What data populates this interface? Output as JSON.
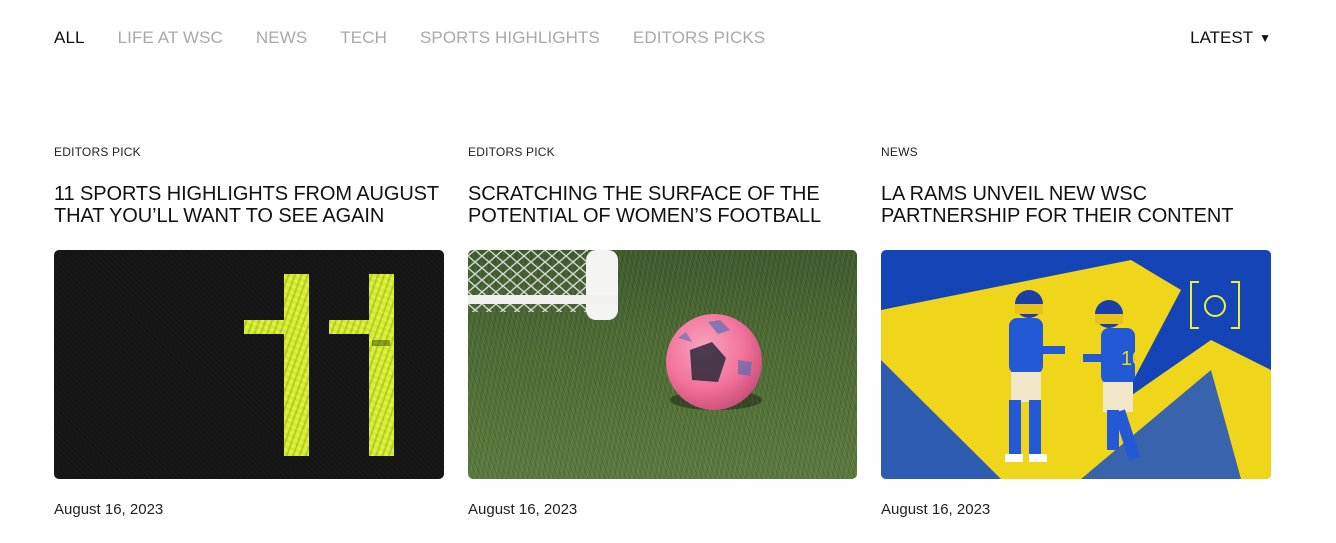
{
  "filters": {
    "items": [
      {
        "label": "ALL",
        "active": true
      },
      {
        "label": "LIFE AT WSC",
        "active": false
      },
      {
        "label": "NEWS",
        "active": false
      },
      {
        "label": "TECH",
        "active": false
      },
      {
        "label": "SPORTS HIGHLIGHTS",
        "active": false
      },
      {
        "label": "EDITORS PICKS",
        "active": false
      }
    ],
    "sort_label": "LATEST",
    "sort_icon": "caret-down-icon"
  },
  "cards": [
    {
      "category": "EDITORS PICK",
      "title_line1": "11 SPORTS HIGHLIGHTS FROM AUGUST",
      "title_line2": "THAT YOU’LL WANT TO SEE AGAIN",
      "date": "August 16, 2023",
      "image": "number-eleven-graphic",
      "image_text": "11"
    },
    {
      "category": "EDITORS PICK",
      "title_line1": "SCRATCHING THE SURFACE OF THE",
      "title_line2": "POTENTIAL OF WOMEN’S FOOTBALL",
      "date": "August 16, 2023",
      "image": "pink-football-on-grass"
    },
    {
      "category": "NEWS",
      "title_line1": "LA RAMS UNVEIL NEW WSC",
      "title_line2": "PARTNERSHIP FOR THEIR CONTENT",
      "date": "August 16, 2023",
      "image": "rams-players-celebrating"
    }
  ],
  "colors": {
    "active_text": "#111111",
    "inactive_text": "#a9a9a9",
    "neon_yellow": "#d8f22e",
    "rams_blue": "#1444b6",
    "rams_yellow": "#f0d61a",
    "ball_pink": "#f2729b"
  }
}
